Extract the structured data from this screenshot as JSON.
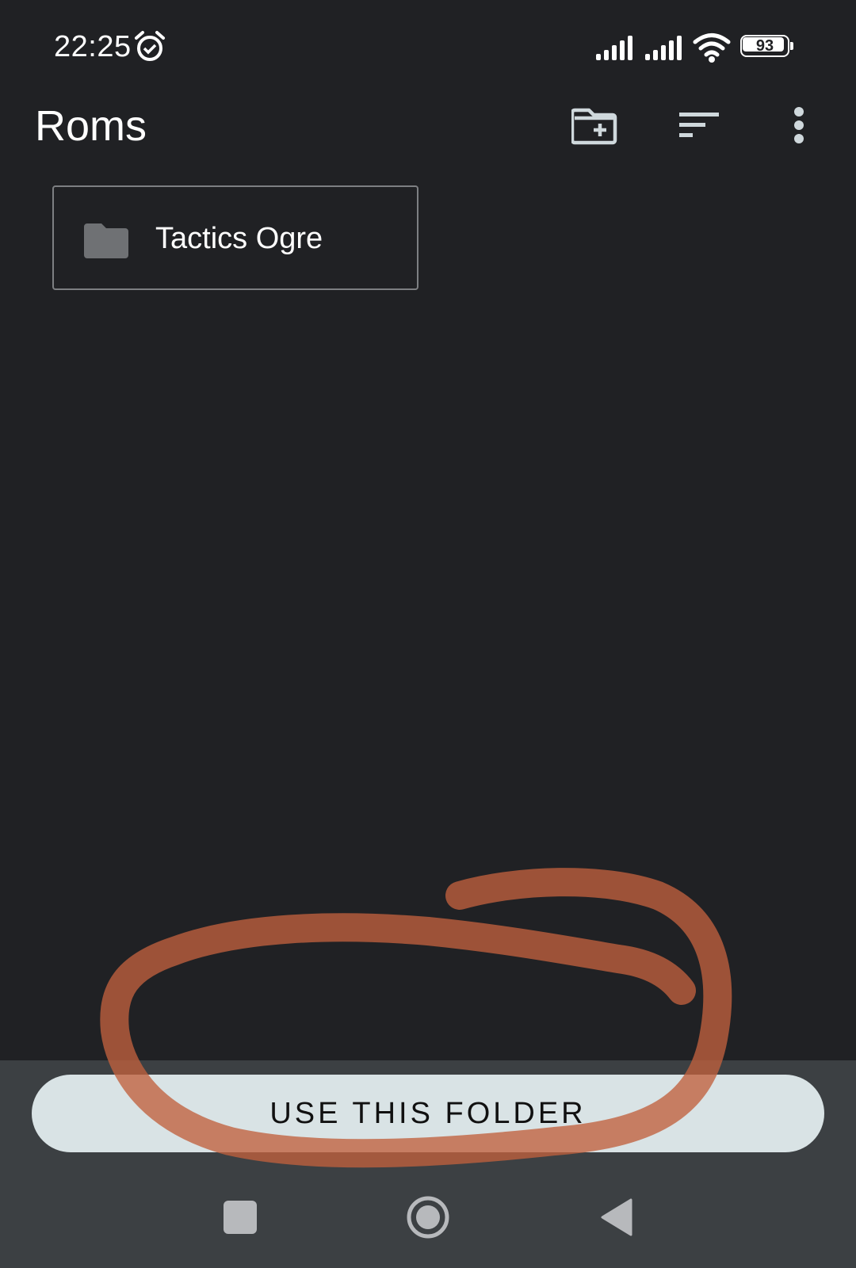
{
  "status_bar": {
    "time": "22:25",
    "battery_level": "93",
    "alarm_icon": "alarm-clock-icon",
    "signal_icon": "cell-signal-icon",
    "wifi_icon": "wifi-icon"
  },
  "toolbar": {
    "title": "Roms",
    "new_folder_icon": "create-new-folder-icon",
    "sort_icon": "sort-icon",
    "more_icon": "more-vert-icon"
  },
  "folders": [
    {
      "name": "Tactics Ogre",
      "icon": "folder-icon"
    }
  ],
  "action": {
    "use_folder_label": "USE THIS FOLDER"
  },
  "nav": {
    "recents_icon": "square-icon",
    "home_icon": "circle-icon",
    "back_icon": "back-triangle-icon"
  },
  "colors": {
    "background": "#202124",
    "bottom_panel": "#3c4043",
    "button_bg": "#d9e3e5",
    "annotation": "#c0603d"
  }
}
